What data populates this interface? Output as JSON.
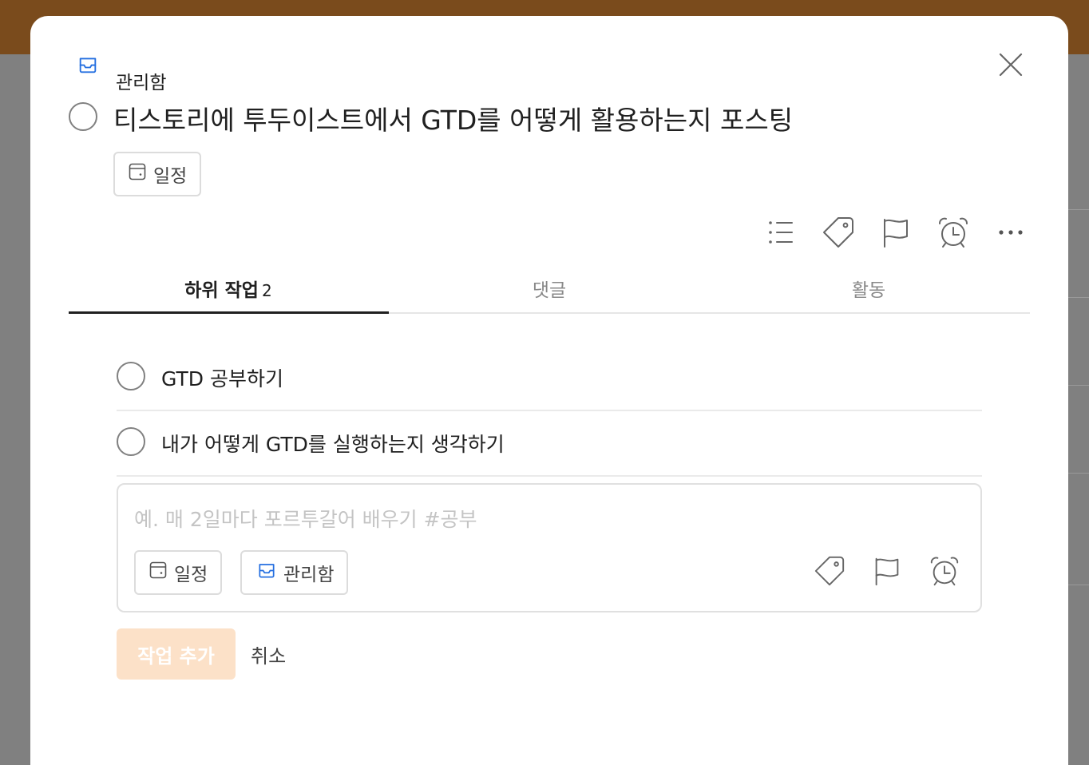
{
  "header": {
    "project_name": "관리함",
    "project_icon": "inbox-icon",
    "close_icon": "close-icon"
  },
  "task": {
    "title": "티스토리에 투두이스트에서 GTD를 어떻게 활용하는지 포스팅",
    "schedule_label": "일정"
  },
  "toolbar": {
    "items": [
      "subtasks-list-icon",
      "label-tag-icon",
      "priority-flag-icon",
      "reminder-alarm-icon",
      "more-icon"
    ]
  },
  "tabs": [
    {
      "label": "하위 작업",
      "count": "2"
    },
    {
      "label": "댓글"
    },
    {
      "label": "활동"
    }
  ],
  "subtasks": [
    {
      "text": "GTD 공부하기"
    },
    {
      "text": "내가 어떻게 GTD를 실행하는지 생각하기"
    }
  ],
  "editor": {
    "placeholder": "예. 매 2일마다 포르투갈어 배우기 #공부",
    "schedule_label": "일정",
    "project_label": "관리함"
  },
  "actions": {
    "add_label": "작업 추가",
    "cancel_label": "취소"
  },
  "colors": {
    "accent": "#db4c3f",
    "inbox_blue": "#246fe0",
    "add_button_disabled": "#fce1c8",
    "topbar": "#7a4b1c"
  }
}
